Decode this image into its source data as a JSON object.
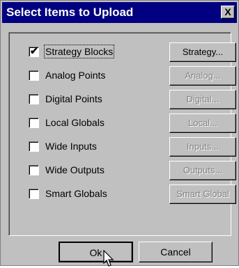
{
  "dialog": {
    "title": "Select Items to Upload",
    "close_label": "X"
  },
  "items": [
    {
      "label": "Strategy Blocks",
      "checked": true,
      "button": "Strategy...",
      "button_enabled": true
    },
    {
      "label": "Analog Points",
      "checked": false,
      "button": "Analog...",
      "button_enabled": false
    },
    {
      "label": "Digital Points",
      "checked": false,
      "button": "Digital...",
      "button_enabled": false
    },
    {
      "label": "Local Globals",
      "checked": false,
      "button": "Local...",
      "button_enabled": false
    },
    {
      "label": "Wide Inputs",
      "checked": false,
      "button": "Inputs...",
      "button_enabled": false
    },
    {
      "label": "Wide Outputs",
      "checked": false,
      "button": "Outputs...",
      "button_enabled": false
    },
    {
      "label": "Smart Globals",
      "checked": false,
      "button": "Smart Global",
      "button_enabled": false
    }
  ],
  "footer": {
    "ok_label": "Ok",
    "cancel_label": "Cancel"
  },
  "check_glyph": "✔"
}
